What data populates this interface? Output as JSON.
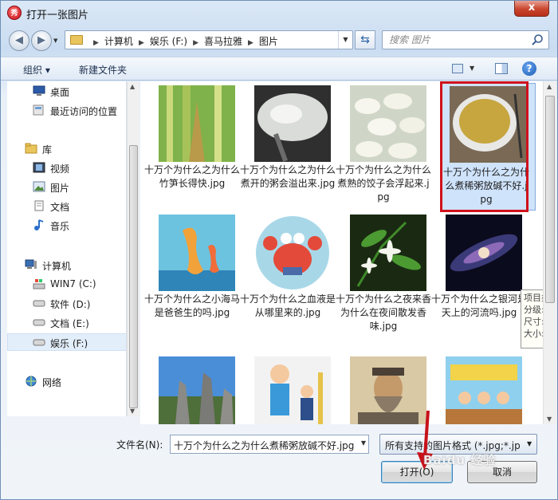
{
  "window": {
    "title": "打开一张图片",
    "close_label": "x"
  },
  "address": {
    "crumbs": [
      "计算机",
      "娱乐 (F:)",
      "喜马拉雅",
      "图片"
    ]
  },
  "search": {
    "placeholder": "搜索 图片"
  },
  "toolbar": {
    "organize_label": "组织 ▾",
    "new_folder_label": "新建文件夹"
  },
  "nav": {
    "items": [
      {
        "label": "桌面",
        "icon": "desktop-icon"
      },
      {
        "label": "最近访问的位置",
        "icon": "recent-icon"
      },
      {
        "label": "库",
        "icon": "library-icon"
      },
      {
        "label": "视频",
        "icon": "video-icon"
      },
      {
        "label": "图片",
        "icon": "pictures-icon"
      },
      {
        "label": "文档",
        "icon": "documents-icon"
      },
      {
        "label": "音乐",
        "icon": "music-icon"
      },
      {
        "label": "计算机",
        "icon": "computer-icon"
      },
      {
        "label": "WIN7 (C:)",
        "icon": "drive-icon"
      },
      {
        "label": "软件 (D:)",
        "icon": "drive-icon"
      },
      {
        "label": "文档 (E:)",
        "icon": "drive-icon"
      },
      {
        "label": "娱乐 (F:)",
        "icon": "drive-icon"
      },
      {
        "label": "网络",
        "icon": "network-icon"
      }
    ]
  },
  "files": [
    {
      "name": "十万个为什么之为什么竹笋长得快.jpg"
    },
    {
      "name": "十万个为什么之为什么煮开的粥会溢出来.jpg"
    },
    {
      "name": "十万个为什么之为什么煮熟的饺子会浮起来.jpg"
    },
    {
      "name": "十万个为什么之为什么煮稀粥放碱不好.jpg"
    },
    {
      "name": "十万个为什么之小海马是爸爸生的吗.jpg"
    },
    {
      "name": "十万个为什么之血液是从哪里来的.jpg"
    },
    {
      "name": "十万个为什么之夜来香为什么在夜间散发香味.jpg"
    },
    {
      "name": "十万个为什么之银河是天上的河流吗.jpg"
    },
    {
      "name": ""
    },
    {
      "name": ""
    },
    {
      "name": ""
    },
    {
      "name": ""
    }
  ],
  "tooltip": {
    "lines": [
      "项目类",
      "分级: 未",
      "尺寸: 50",
      "大小: 83"
    ]
  },
  "bottom": {
    "filename_label": "文件名(N):",
    "filename_value": "十万个为什么之为什么煮稀粥放碱不好.jpg",
    "filter_value": "所有支持的图片格式 (*.jpg;*.jp",
    "open_label": "打开(O)",
    "cancel_label": "取消"
  },
  "watermark": "Baidu 经验",
  "colors": {
    "accent": "#d0121b",
    "selection": "#cfe3fb"
  }
}
